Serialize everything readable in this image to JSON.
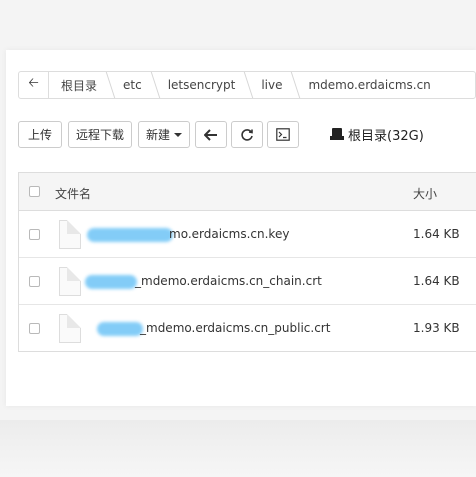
{
  "breadcrumb": {
    "items": [
      "根目录",
      "etc",
      "letsencrypt",
      "live",
      "mdemo.erdaicms.cn"
    ]
  },
  "toolbar": {
    "upload_label": "上传",
    "remote_download_label": "远程下载",
    "new_label": "新建",
    "disk_label": "根目录(32G)"
  },
  "table": {
    "columns": [
      "文件名",
      "大小"
    ],
    "rows": [
      {
        "name_visible": "mo.erdaicms.cn.key",
        "size": "1.64 KB"
      },
      {
        "name_visible": "_mdemo.erdaicms.cn_chain.crt",
        "size": "1.64 KB"
      },
      {
        "name_visible": "_mdemo.erdaicms.cn_public.crt",
        "size": "1.93 KB"
      }
    ]
  },
  "colors": {
    "redaction": "#6ec4f6",
    "border": "#dddddd",
    "header_bg": "#f5f5f5"
  },
  "icons": [
    "arrow-left-icon",
    "refresh-icon",
    "terminal-icon",
    "hard-drive-icon",
    "file-icon"
  ]
}
